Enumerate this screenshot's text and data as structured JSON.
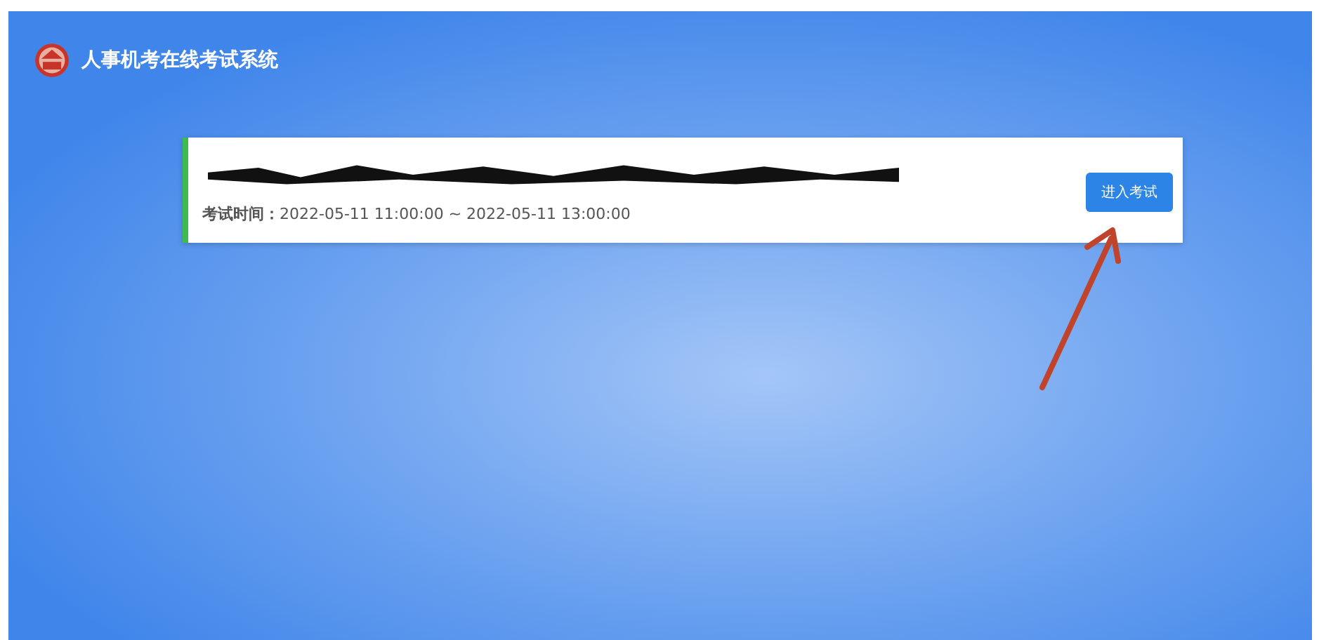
{
  "header": {
    "title": "人事机考在线考试系统"
  },
  "exam": {
    "title_redacted": true,
    "time_label": "考试时间：",
    "time_value": "2022-05-11 11:00:00 ~ 2022-05-11 13:00:00",
    "button": "进入考试"
  }
}
